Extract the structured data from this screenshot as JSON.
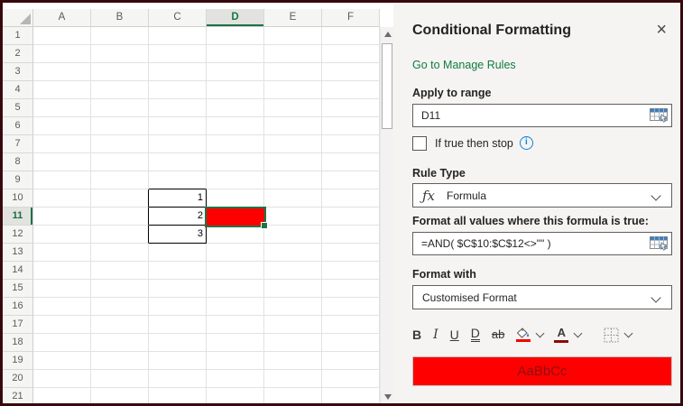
{
  "panel": {
    "title": "Conditional Formatting",
    "manage_rules_link": "Go to Manage Rules",
    "apply_to_range": {
      "label": "Apply to range",
      "value": "D11"
    },
    "stop_checkbox": {
      "label": "If true then stop",
      "checked": false
    },
    "rule_type": {
      "label": "Rule Type",
      "value": "Formula"
    },
    "formula": {
      "label": "Format all values where this formula is true:",
      "value": "=AND( $C$10:$C$12<>\"\" )"
    },
    "format_with": {
      "label": "Format with",
      "value": "Customised Format"
    },
    "toolbar": {
      "bold": "B",
      "italic": "I",
      "underline": "U",
      "double_underline": "D",
      "strikethrough": "ab",
      "font_color_letter": "A",
      "fill_color": "#f60000",
      "font_color": "#8a0b0b"
    },
    "preview": {
      "text": "AaBbCc",
      "fill_color": "#fe0000",
      "text_color": "#8b1212"
    }
  },
  "icons": {
    "close": "×",
    "info": "i",
    "fx": "ƒx"
  },
  "grid": {
    "columns": [
      "A",
      "B",
      "C",
      "D",
      "E",
      "F"
    ],
    "row_count": 21,
    "cells": {
      "C10": "1",
      "C11": "2",
      "C12": "3"
    },
    "boxed_range": [
      "C10",
      "C11",
      "C12"
    ],
    "active_cell": "D11",
    "selected_column": "D",
    "selected_row": 11,
    "active_cell_fill": "#fe0000",
    "selection_green": "#217346"
  }
}
